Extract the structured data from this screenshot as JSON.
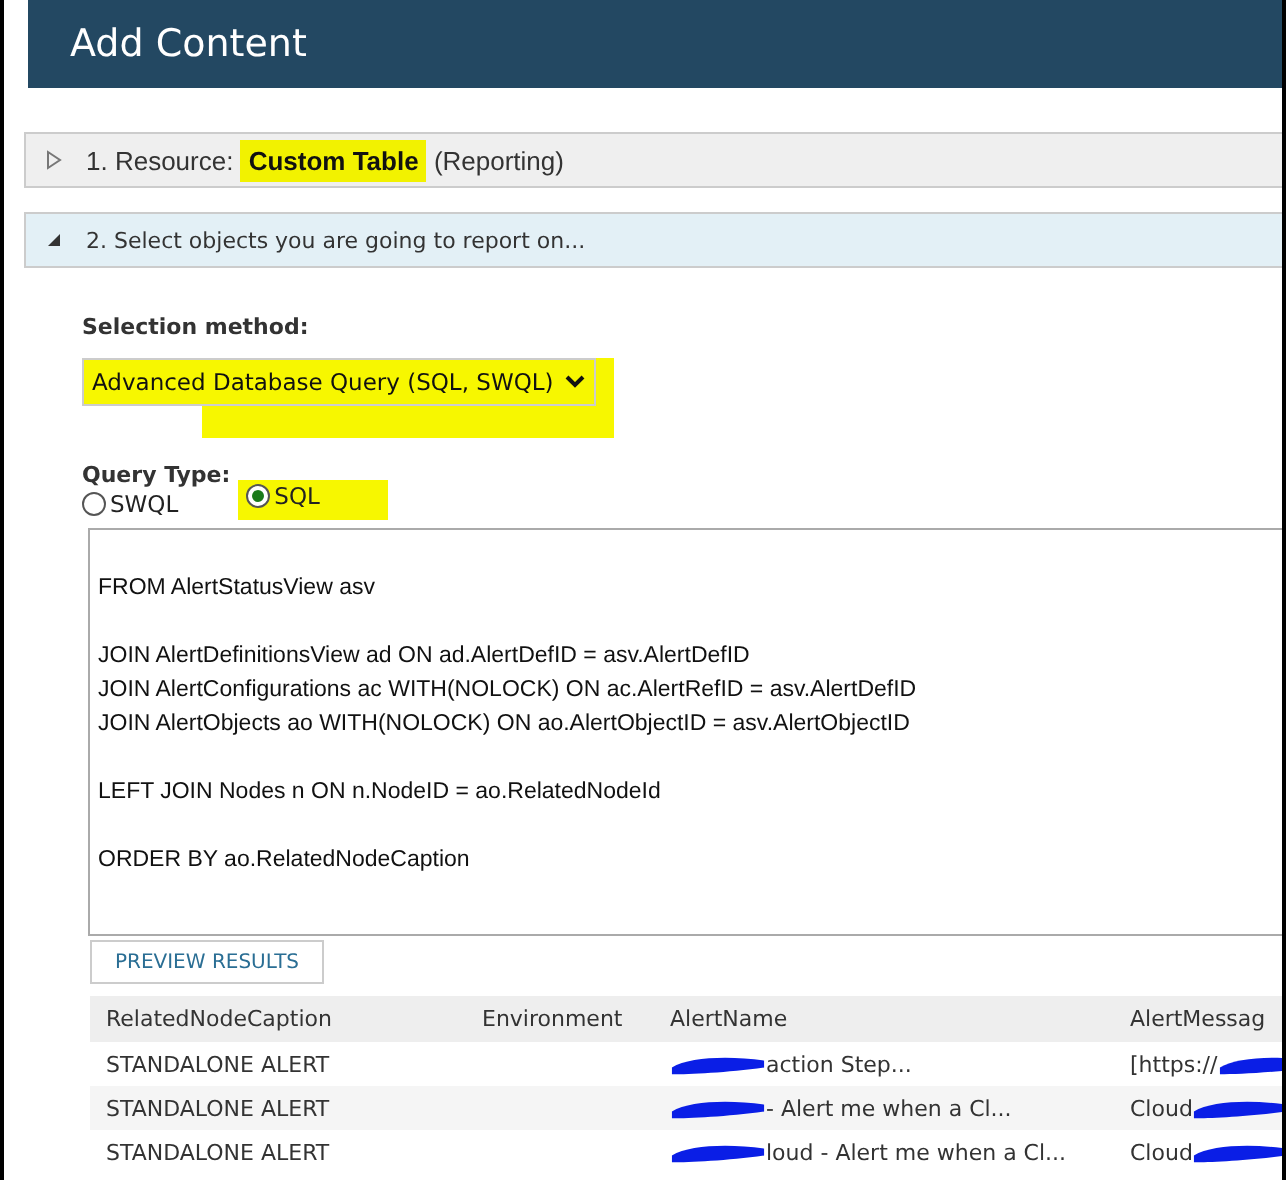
{
  "window": {
    "title": "Add Content"
  },
  "sections": [
    {
      "title": "1. Resource: **Custom Table** (Reporting)",
      "expanded": false
    },
    {
      "title": "2. Select objects you are going to report on...",
      "expanded": true
    }
  ],
  "selection_method": {
    "label": "Selection method:",
    "value": "Advanced Database Query (SQL, SWQL)"
  },
  "query_type": {
    "label": "Query Type:",
    "options": [
      {
        "label": "SWQL",
        "selected": false
      },
      {
        "label": "SQL",
        "selected": true
      }
    ]
  },
  "query_blocks": [
    [
      "FROM AlertStatusView asv"
    ],
    [
      "JOIN AlertDefinitionsView ad ON ad.AlertDefID = asv.AlertDefID",
      "JOIN AlertConfigurations ac WITH(NOLOCK) ON ac.AlertRefID = asv.AlertDefID",
      "JOIN AlertObjects ao WITH(NOLOCK) ON ao.AlertObjectID = asv.AlertObjectID"
    ],
    [
      "LEFT JOIN Nodes n ON n.NodeID = ao.RelatedNodeId"
    ],
    [
      "ORDER BY ao.RelatedNodeCaption"
    ]
  ],
  "preview_button": "PREVIEW RESULTS",
  "table": {
    "columns": [
      "RelatedNodeCaption",
      "Environment",
      "AlertName",
      "AlertMessag"
    ],
    "rows": [
      [
        {
          "text": "STANDALONE ALERT"
        },
        {},
        {
          "text": "action Step...",
          "redacted_before": true
        },
        {
          "text": "[https://",
          "redacted_after": true
        }
      ],
      [
        {
          "text": "STANDALONE ALERT"
        },
        {},
        {
          "text": "- Alert me when a Cl...",
          "redacted_before": true
        },
        {
          "text": "Cloud",
          "redacted_after": true
        }
      ],
      [
        {
          "text": "STANDALONE ALERT"
        },
        {},
        {
          "text": "loud - Alert me when a Cl...",
          "redacted_before": true
        },
        {
          "text": "Cloud",
          "redacted_after": true
        }
      ]
    ]
  }
}
